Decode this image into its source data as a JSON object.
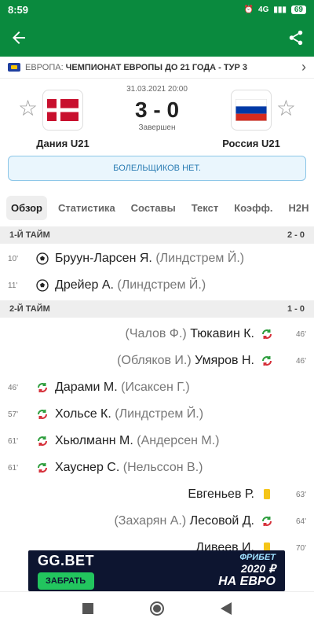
{
  "status_bar": {
    "time": "8:59",
    "network": "4G",
    "battery": "69"
  },
  "league": {
    "country": "ЕВРОПА:",
    "name": "ЧЕМПИОНАТ ЕВРОПЫ ДО 21 ГОДА - ТУР 3"
  },
  "match": {
    "date": "31.03.2021 20:00",
    "score": "3 - 0",
    "status": "Завершен",
    "home_team": "Дания U21",
    "away_team": "Россия U21"
  },
  "fans_text": "БОЛЕЛЬЩИКОВ НЕТ.",
  "tabs": [
    "Обзор",
    "Статистика",
    "Составы",
    "Текст",
    "Коэфф.",
    "H2H"
  ],
  "sections": [
    {
      "title": "1-Й ТАЙМ",
      "score": "2 - 0"
    },
    {
      "title": "2-Й ТАЙМ",
      "score": "1 - 0"
    }
  ],
  "events": [
    {
      "minute": "10'",
      "player": "Бруун-Ларсен Я.",
      "assist": "(Линдстрем Й.)",
      "type": "goal",
      "side": "home"
    },
    {
      "minute": "11'",
      "player": "Дрейер А.",
      "assist": "(Линдстрем Й.)",
      "type": "goal",
      "side": "home"
    },
    {
      "minute": "46'",
      "player": "Тюкавин К.",
      "assist": "(Чалов Ф.)",
      "type": "sub",
      "side": "away"
    },
    {
      "minute": "46'",
      "player": "Умяров Н.",
      "assist": "(Обляков И.)",
      "type": "sub",
      "side": "away"
    },
    {
      "minute": "46'",
      "player": "Дарами М.",
      "assist": "(Исаксен Г.)",
      "type": "sub",
      "side": "home"
    },
    {
      "minute": "57'",
      "player": "Хольсе К.",
      "assist": "(Линдстрем Й.)",
      "type": "sub",
      "side": "home"
    },
    {
      "minute": "61'",
      "player": "Хьюлманн М.",
      "assist": "(Андерсен М.)",
      "type": "sub",
      "side": "home"
    },
    {
      "minute": "61'",
      "player": "Хауснер С.",
      "assist": "(Нельссон В.)",
      "type": "sub",
      "side": "home"
    },
    {
      "minute": "63'",
      "player": "Евгеньев Р.",
      "assist": "",
      "type": "yellow",
      "side": "away"
    },
    {
      "minute": "64'",
      "player": "Лесовой Д.",
      "assist": "(Захарян А.)",
      "type": "sub",
      "side": "away"
    },
    {
      "minute": "70'",
      "player": "Дивеев И.",
      "assist": "",
      "type": "yellow",
      "side": "away"
    }
  ],
  "ad": {
    "brand": "GG.BET",
    "cta": "ЗАБРАТЬ",
    "promo_1": "ФРИБЕТ",
    "promo_2": "2020 ₽",
    "promo_3": "НА ЕВРО"
  },
  "colors": {
    "primary_green": "#0a8a3e",
    "denmark_red": "#c8102e",
    "russia_blue": "#0039a6",
    "russia_red": "#d52b1e"
  }
}
